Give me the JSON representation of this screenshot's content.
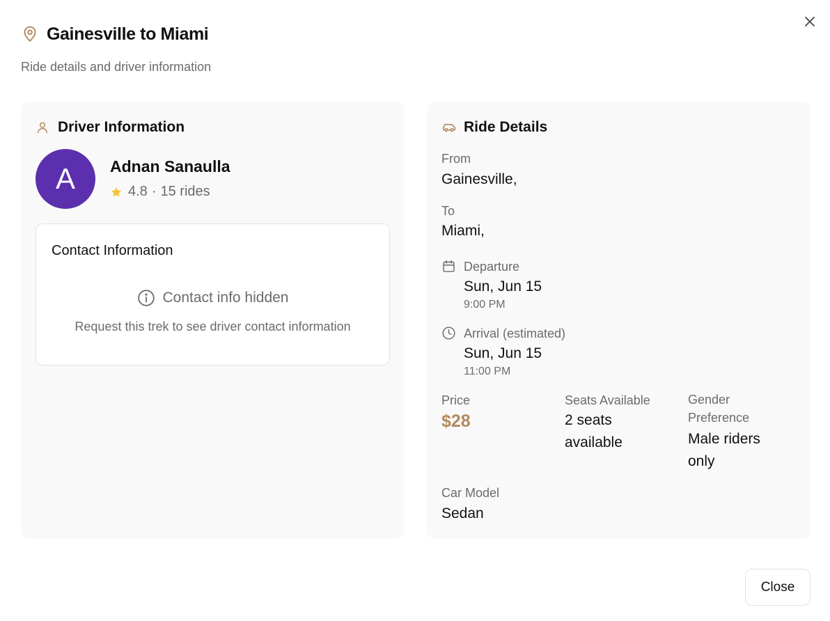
{
  "colors": {
    "accent": "#b38a5f",
    "avatar_bg": "#5b2fae",
    "star": "#f4c430",
    "muted_text": "#6b6b6b",
    "card_bg": "#f9f9f9"
  },
  "header": {
    "title": "Gainesville to Miami",
    "subtitle": "Ride details and driver information",
    "icon": "map-pin-icon",
    "close_icon": "close-icon"
  },
  "driver": {
    "section_title": "Driver Information",
    "section_icon": "user-icon",
    "avatar_initial": "A",
    "name": "Adnan Sanaulla",
    "rating": "4.8",
    "separator": "·",
    "rides": "15 rides",
    "rating_icon": "star-icon",
    "contact": {
      "title": "Contact Information",
      "hidden_label": "Contact info hidden",
      "hidden_icon": "info-icon",
      "description": "Request this trek to see driver contact information"
    }
  },
  "ride": {
    "section_title": "Ride Details",
    "section_icon": "car-icon",
    "from_label": "From",
    "from_value": "Gainesville,",
    "to_label": "To",
    "to_value": "Miami,",
    "departure": {
      "label": "Departure",
      "icon": "calendar-icon",
      "date": "Sun, Jun 15",
      "time": "9:00 PM"
    },
    "arrival": {
      "label": "Arrival (estimated)",
      "icon": "clock-icon",
      "date": "Sun, Jun 15",
      "time": "11:00 PM"
    },
    "price_label": "Price",
    "price_value": "$28",
    "seats_label": "Seats Available",
    "seats_value": "2 seats available",
    "gender_label": "Gender Preference",
    "gender_value": "Male riders only",
    "car_label": "Car Model",
    "car_value": "Sedan"
  },
  "footer": {
    "close_label": "Close"
  }
}
